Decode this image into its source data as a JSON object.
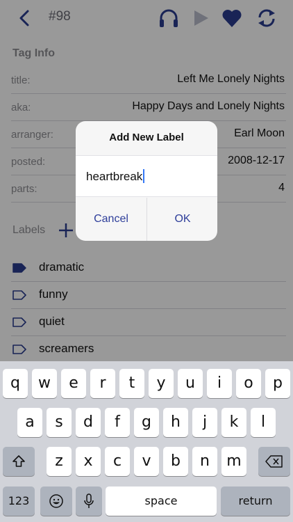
{
  "nav": {
    "title": "#98"
  },
  "tag_info": {
    "heading": "Tag Info",
    "rows": [
      {
        "key": "title:",
        "value": "Left Me Lonely Nights"
      },
      {
        "key": "aka:",
        "value": "Happy Days and Lonely Nights"
      },
      {
        "key": "arranger:",
        "value": "Earl Moon"
      },
      {
        "key": "posted:",
        "value": "2008-12-17"
      },
      {
        "key": "parts:",
        "value": "4"
      }
    ]
  },
  "labels": {
    "heading": "Labels",
    "items": [
      {
        "text": "dramatic",
        "filled": true
      },
      {
        "text": "funny",
        "filled": false
      },
      {
        "text": "quiet",
        "filled": false
      },
      {
        "text": "screamers",
        "filled": false
      }
    ]
  },
  "dialog": {
    "title": "Add New Label",
    "value": "heartbreak",
    "cancel": "Cancel",
    "ok": "OK"
  },
  "keyboard": {
    "row1": [
      "q",
      "w",
      "e",
      "r",
      "t",
      "y",
      "u",
      "i",
      "o",
      "p"
    ],
    "row2": [
      "a",
      "s",
      "d",
      "f",
      "g",
      "h",
      "j",
      "k",
      "l"
    ],
    "row3": [
      "z",
      "x",
      "c",
      "v",
      "b",
      "n",
      "m"
    ],
    "numbers": "123",
    "space": "space",
    "return": "return"
  },
  "colors": {
    "accent": "#2e3e9a",
    "icon": "#2b3c8f"
  }
}
